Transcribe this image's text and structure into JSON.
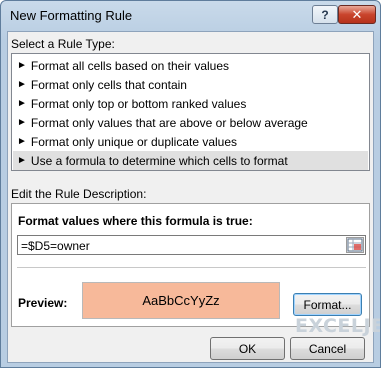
{
  "window": {
    "title": "New Formatting Rule",
    "help_label": "?",
    "close_label": "✕"
  },
  "rule_type": {
    "label": "Select a Rule Type:",
    "items": [
      {
        "label": "Format all cells based on their values"
      },
      {
        "label": "Format only cells that contain"
      },
      {
        "label": "Format only top or bottom ranked values"
      },
      {
        "label": "Format only values that are above or below average"
      },
      {
        "label": "Format only unique or duplicate values"
      },
      {
        "label": "Use a formula to determine which cells to format"
      }
    ],
    "selected_index": 5,
    "bullet": "►"
  },
  "description": {
    "label": "Edit the Rule Description:",
    "formula_heading": "Format values where this formula is true:",
    "formula_value": "=$D5=owner",
    "preview_label": "Preview:",
    "preview_sample": "AaBbCcYyZz",
    "preview_fill": "#f7b99a",
    "format_button": "Format..."
  },
  "buttons": {
    "ok": "OK",
    "cancel": "Cancel"
  },
  "watermark": "EXCELJET"
}
